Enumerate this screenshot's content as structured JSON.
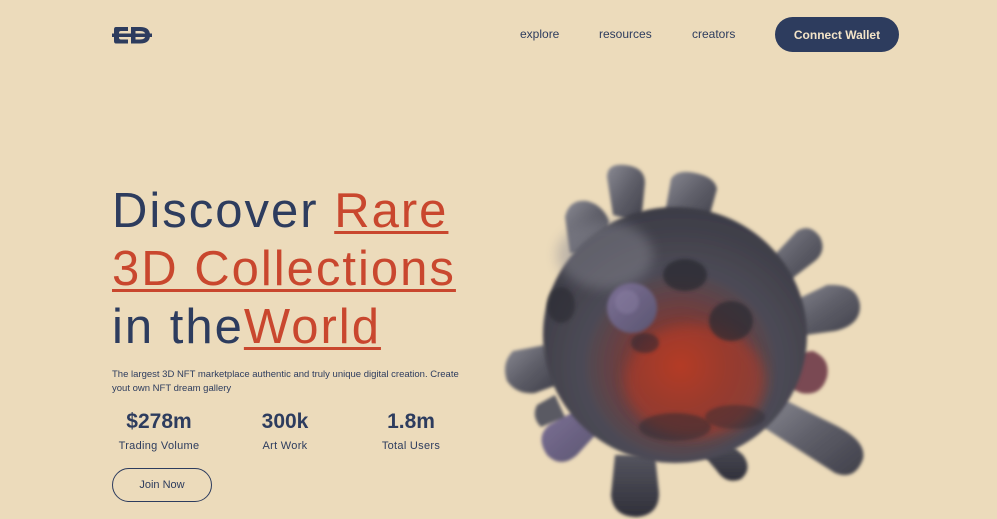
{
  "brand": {
    "logo_text": "ƐD",
    "icon": "ed-logo"
  },
  "nav": {
    "items": [
      {
        "label": "explore"
      },
      {
        "label": "resources"
      },
      {
        "label": "creators"
      }
    ],
    "cta_label": "Connect Wallet"
  },
  "hero": {
    "title": {
      "line1_plain": "Discover ",
      "line1_accent": "Rare",
      "line2_accent": "3D Collections",
      "line3_plain": "in the",
      "line3_accent": "World"
    },
    "description": "The largest 3D NFT marketplace authentic and truly unique digital creation. Create yout own NFT dream gallery",
    "stats": [
      {
        "value": "$278m",
        "label": "Trading Volume"
      },
      {
        "value": "300k",
        "label": "Art Work"
      },
      {
        "value": "1.8m",
        "label": "Total Users"
      }
    ],
    "join_label": "Join Now",
    "image_icon": "3d-virus-sculpture"
  },
  "colors": {
    "background": "#ecdbbb",
    "primary": "#2d3c5e",
    "accent": "#c9472e",
    "button_text": "#f3e4c8"
  }
}
